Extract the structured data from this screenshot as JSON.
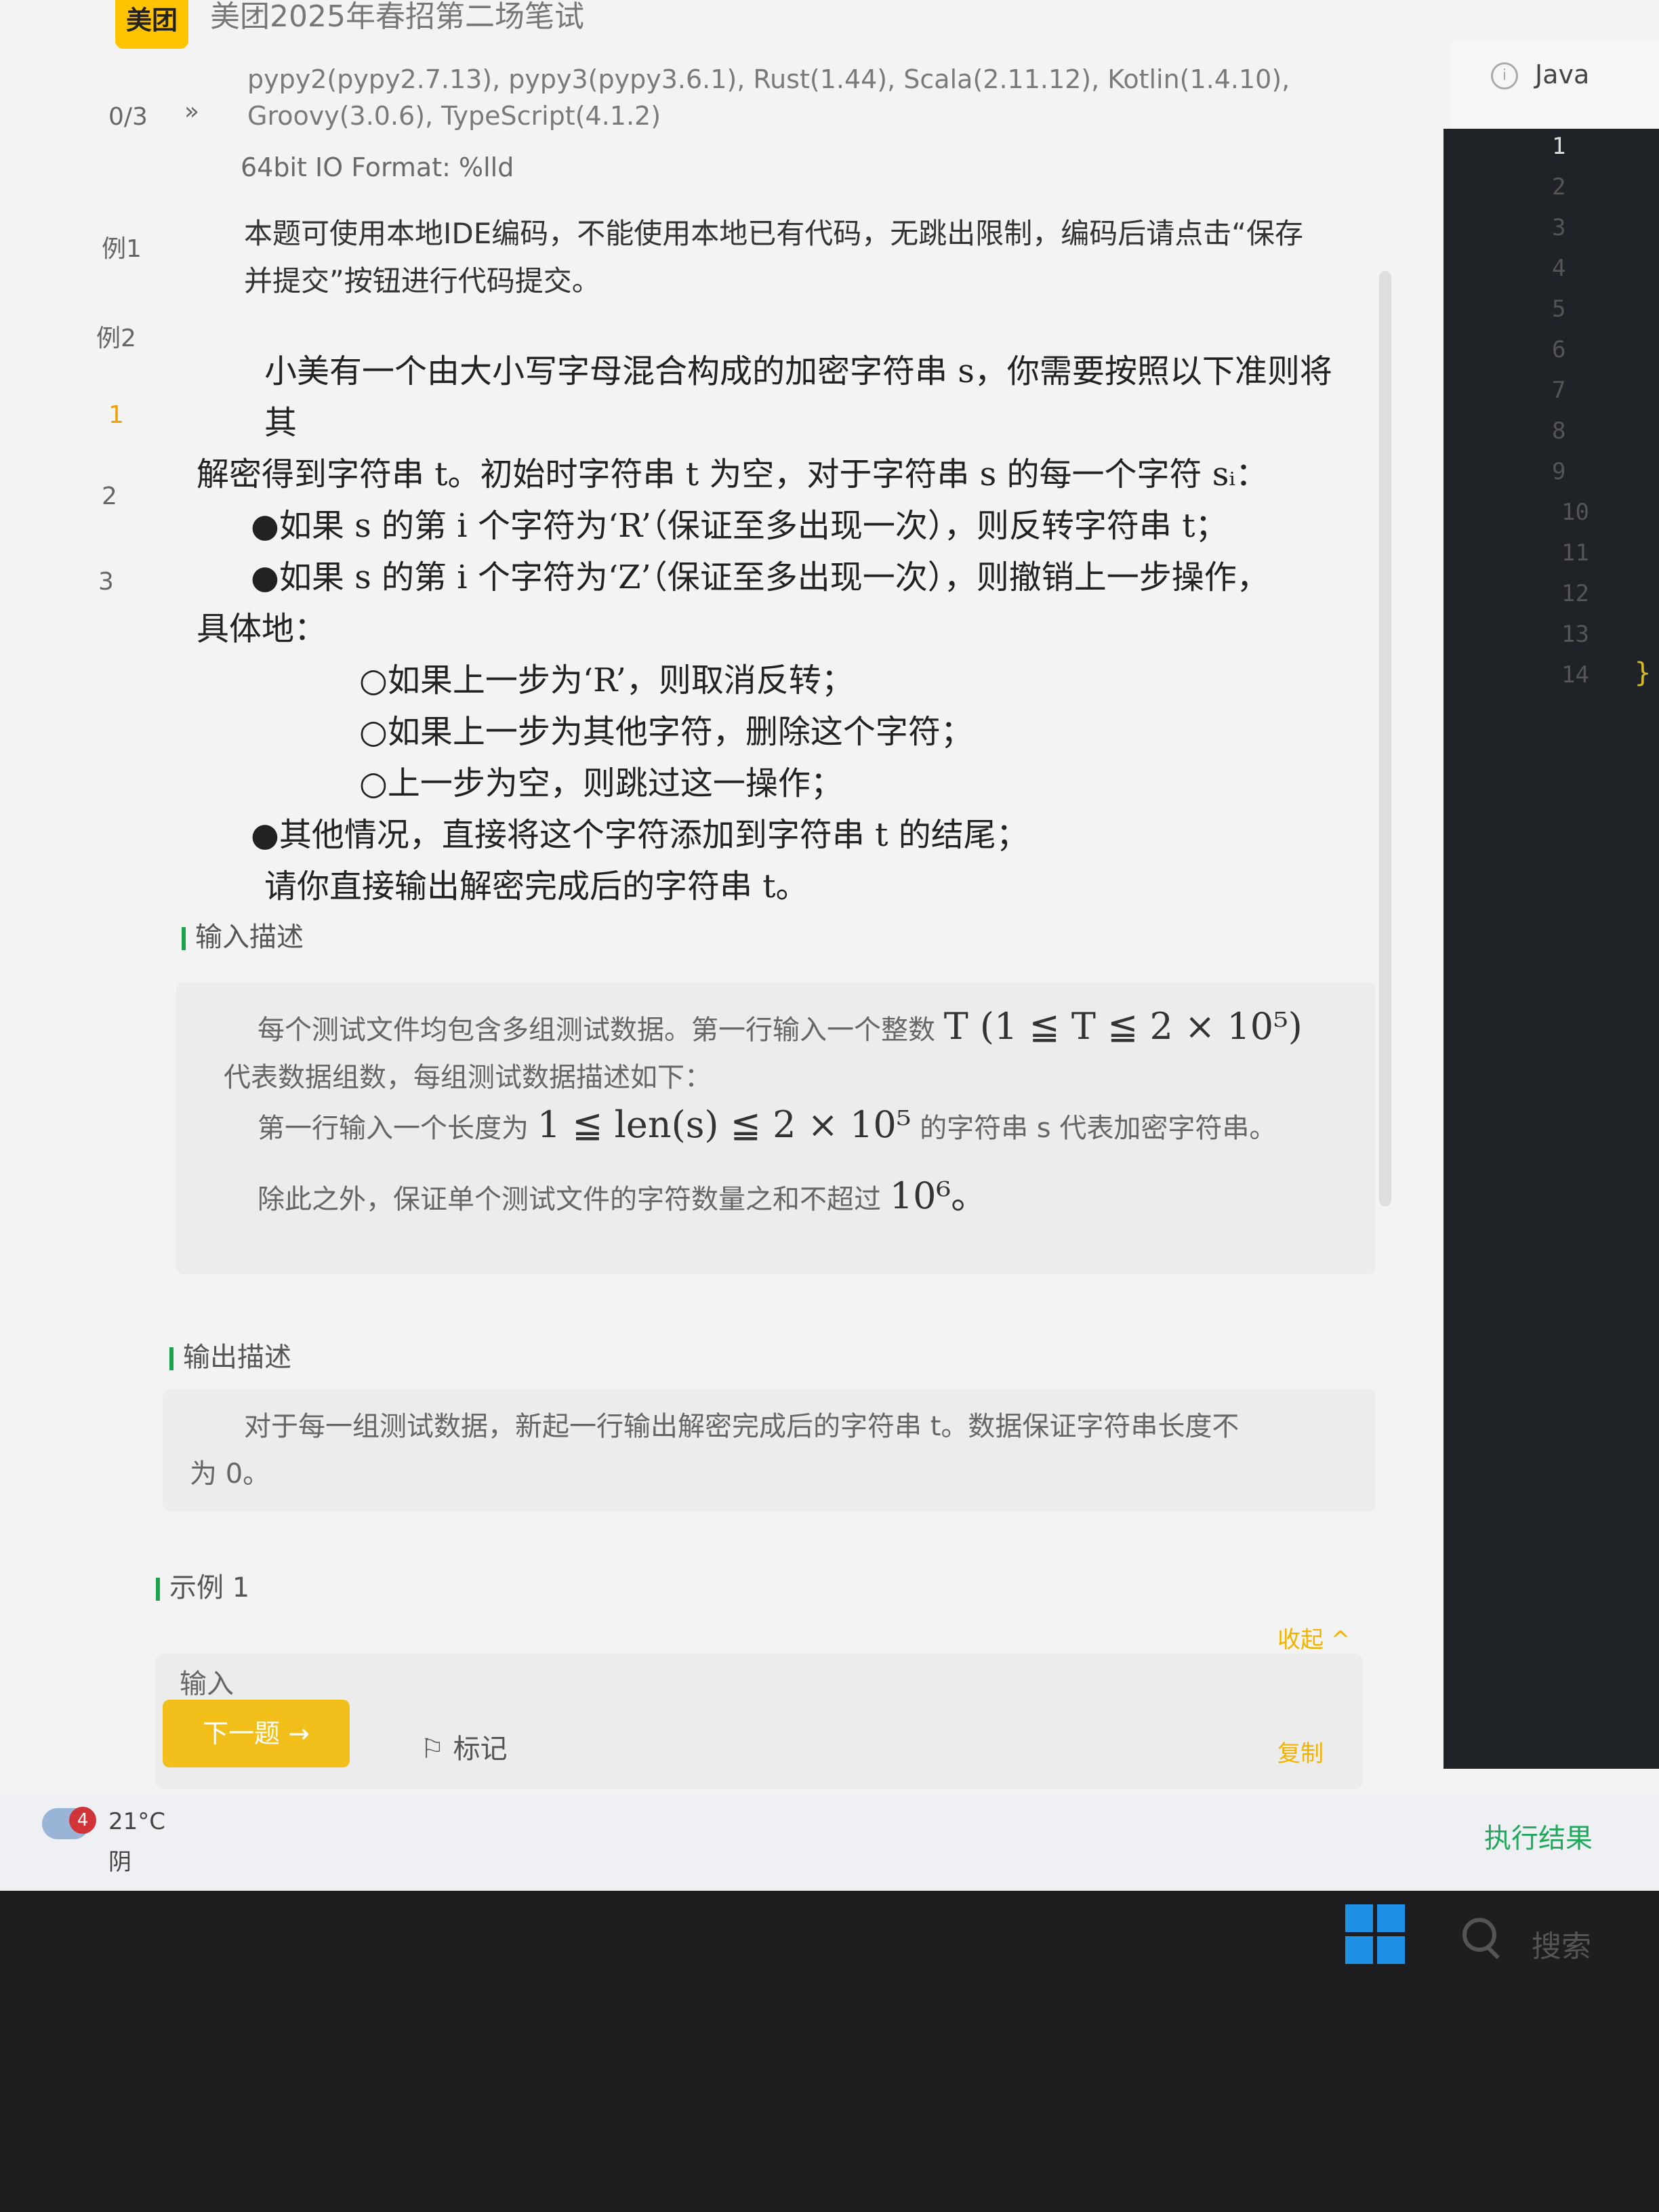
{
  "header": {
    "logo": "美团",
    "title": "美团2025年春招第二场笔试"
  },
  "left_rail": {
    "items": [
      "0/3",
      "»",
      "例1",
      "例2",
      "1",
      "2",
      "3"
    ]
  },
  "problem": {
    "languages_line1": "pypy2(pypy2.7.13), pypy3(pypy3.6.1), Rust(1.44), Scala(2.11.12), Kotlin(1.4.10),",
    "languages_line2": "Groovy(3.0.6), TypeScript(4.1.2)",
    "io_format": "64bit IO Format: %lld",
    "notice_line1": "本题可使用本地IDE编码，不能使用本地已有代码，无跳出限制，编码后请点击“保存",
    "notice_line2": "并提交”按钮进行代码提交。",
    "statement": [
      "小美有一个由大小写字母混合构成的加密字符串 s，你需要按照以下准则将其",
      "解密得到字符串 t。初始时字符串 t 为空，对于字符串 s 的每一个字符 sᵢ：",
      "●如果 s 的第 i 个字符为‘R’（保证至多出现一次），则反转字符串 t；",
      "●如果 s 的第 i 个字符为‘Z’（保证至多出现一次），则撤销上一步操作，",
      "具体地：",
      "○如果上一步为‘R’，则取消反转；",
      "○如果上一步为其他字符，删除这个字符；",
      "○上一步为空，则跳过这一操作；",
      "●其他情况，直接将这个字符添加到字符串 t 的结尾；",
      "请你直接输出解密完成后的字符串 t。"
    ],
    "input_title": "输入描述",
    "input_line1": "每个测试文件均包含多组测试数据。第一行输入一个整数",
    "input_math1": "T (1 ≦ T ≦ 2 × 10⁵)",
    "input_line2": "代表数据组数，每组测试数据描述如下：",
    "input_line3a": "第一行输入一个长度为",
    "input_math2": "1 ≦ len(s) ≦ 2 × 10⁵",
    "input_line3b": "的字符串 s 代表加密字符串。",
    "input_line4a": "除此之外，保证单个测试文件的字符数量之和不超过",
    "input_math3": "10⁶。",
    "output_title": "输出描述",
    "output_line1": "对于每一组测试数据，新起一行输出解密完成后的字符串 t。数据保证字符串长度不",
    "output_line2": "为 0。",
    "example_title": "示例 1",
    "collapse": "收起 ^",
    "input_label": "输入",
    "copy": "复制",
    "next_button": "下一题 →",
    "mark_button": "标记"
  },
  "editor": {
    "language": "Java",
    "line_numbers": [
      "1",
      "2",
      "3",
      "4",
      "5",
      "6",
      "7",
      "8",
      "9",
      "10",
      "11",
      "12",
      "13",
      "14"
    ],
    "closing_brace": "}",
    "run_button": "执行结果"
  },
  "taskbar": {
    "badge": "4",
    "temperature": "21°C",
    "condition": "阴",
    "search": "搜索"
  }
}
